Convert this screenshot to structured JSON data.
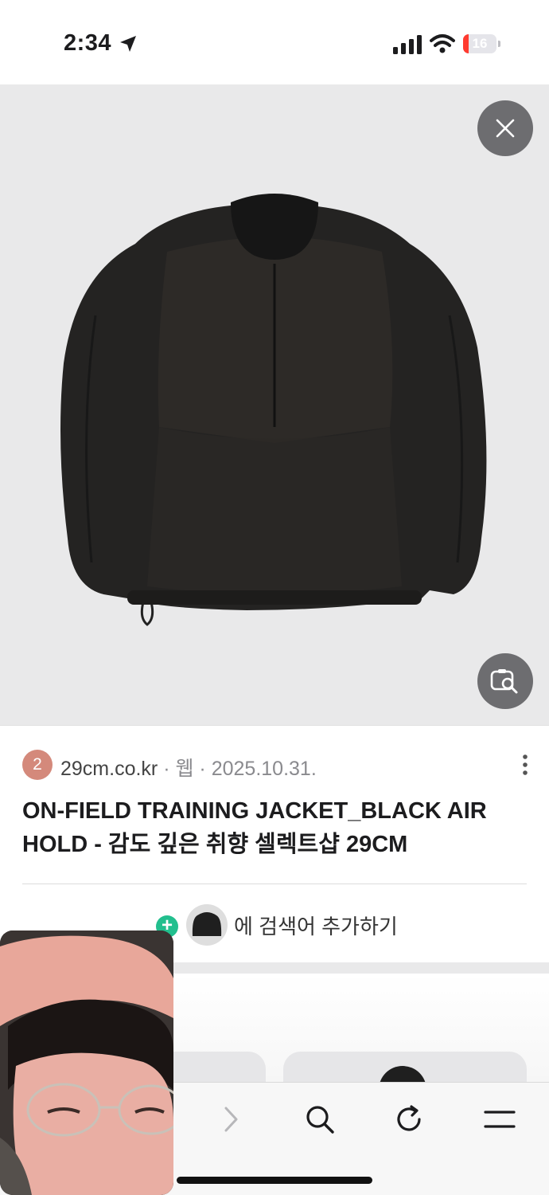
{
  "status_bar": {
    "time": "2:34",
    "battery_level": "16",
    "battery_fraction": 0.16,
    "battery_color": "#ff3b30",
    "icons": [
      "location-arrow-icon",
      "signal-icon",
      "wifi-icon",
      "battery-icon"
    ]
  },
  "result": {
    "source_index": "2",
    "source_domain": "29cm.co.kr",
    "source_meta": " · 웹 · 2025.10.31.",
    "title": "ON-FIELD TRAINING JACKET_BLACK AIR HOLD - 감도 깊은 취향 셀렉트샵 29CM",
    "add_search_label": "에 검색어 추가하기",
    "badge_color": "#d4897b",
    "plus_color": "#22bf8e"
  },
  "toolbar": {
    "icons": [
      "back-arrow-icon",
      "forward-arrow-icon",
      "search-icon",
      "reload-icon",
      "menu-icon"
    ]
  }
}
